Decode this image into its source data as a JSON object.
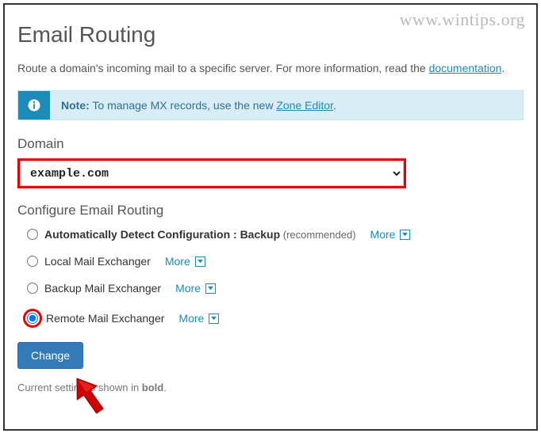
{
  "watermark": "www.wintips.org",
  "header": {
    "title": "Email Routing"
  },
  "intro": {
    "text_before_link": "Route a domain's incoming mail to a specific server. For more information, read the ",
    "link_text": "documentation",
    "text_after_link": "."
  },
  "info_banner": {
    "note_label": "Note:",
    "text_before_link": " To manage MX records, use the new ",
    "link_text": "Zone Editor",
    "text_after_link": "."
  },
  "domain": {
    "label": "Domain",
    "selected": "example.com"
  },
  "configure": {
    "label": "Configure Email Routing",
    "more_label": "More",
    "options": [
      {
        "label": "Automatically Detect Configuration : Backup",
        "recommended": " (recommended)",
        "bold": true,
        "selected": false,
        "highlighted": false
      },
      {
        "label": "Local Mail Exchanger",
        "recommended": "",
        "bold": false,
        "selected": false,
        "highlighted": false
      },
      {
        "label": "Backup Mail Exchanger",
        "recommended": "",
        "bold": false,
        "selected": false,
        "highlighted": false
      },
      {
        "label": "Remote Mail Exchanger",
        "recommended": "",
        "bold": false,
        "selected": true,
        "highlighted": true
      }
    ]
  },
  "actions": {
    "change_label": "Change"
  },
  "footer": {
    "current_before_bold": "Current setting is shown in ",
    "current_bold": "bold",
    "current_after_bold": "."
  }
}
